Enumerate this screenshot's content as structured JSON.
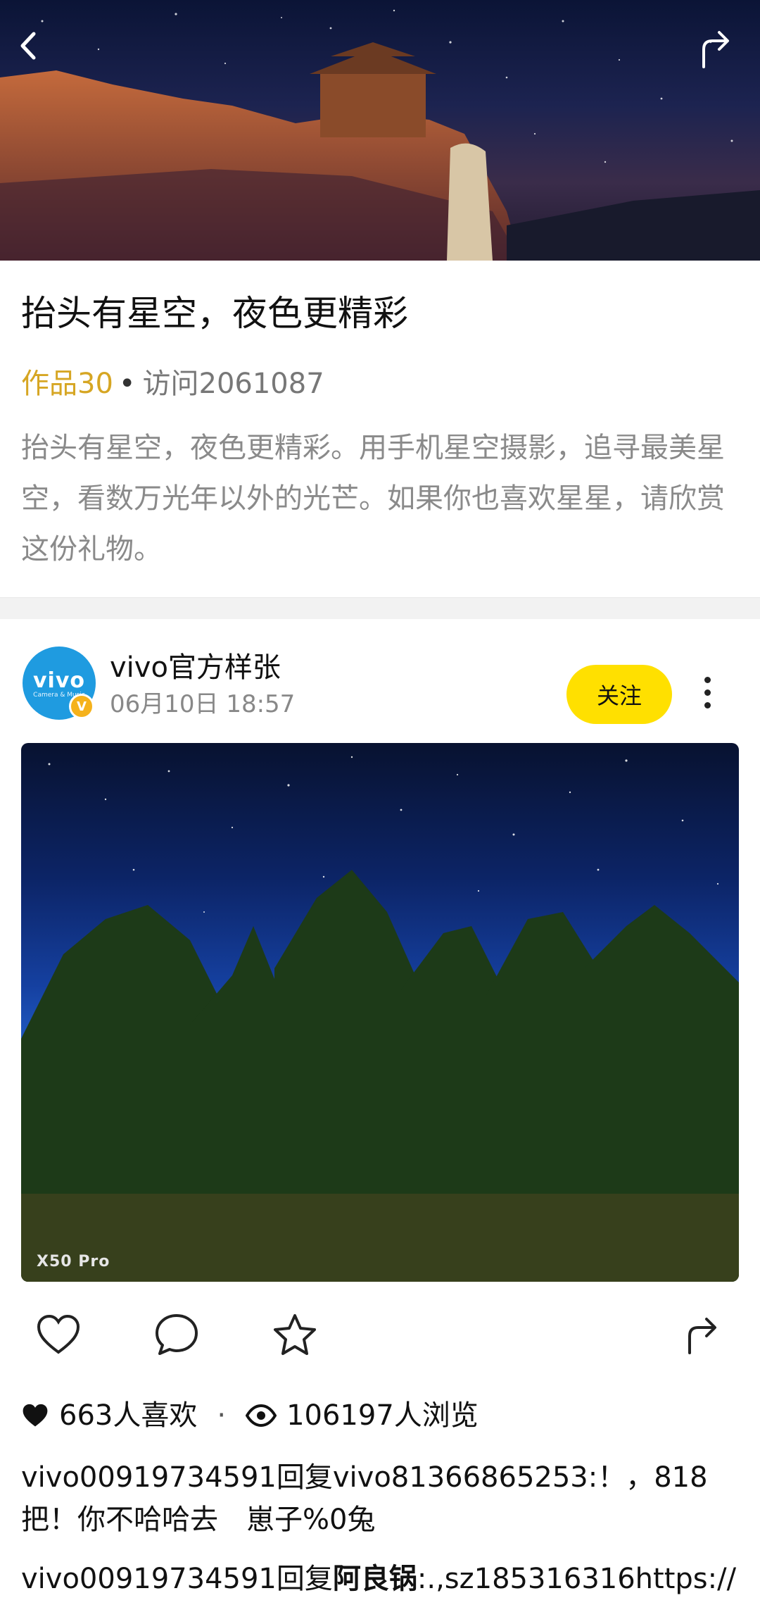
{
  "header": {
    "back_icon": "chevron-left-icon",
    "share_icon": "share-arrow-icon"
  },
  "collection": {
    "title": "抬头有星空，夜色更精彩",
    "works": "作品30",
    "visits": "访问2061087",
    "description": "抬头有星空，夜色更精彩。用手机星空摄影，追寻最美星空，看数万光年以外的光芒。如果你也喜欢星星，请欣赏这份礼物。"
  },
  "post": {
    "author": "vivo官方样张",
    "date": "06月10日 18:57",
    "avatar_logo": "vivo",
    "avatar_sub": "Camera & Music",
    "follow_label": "关注",
    "watermark": "X50 Pro",
    "likes": "663人喜欢",
    "views": "106197人浏览"
  },
  "comments": [
    {
      "user": "vivo00919734591",
      "reply_word": "回复",
      "target": "vivo81366865253",
      "text": ":！，818把！你不哈哈去　崽子%0兔"
    },
    {
      "user": "vivo00919734591",
      "reply_word": "回复",
      "target": "阿良锅",
      "text": ":.,sz185316316https://"
    }
  ],
  "colors": {
    "accent_yellow": "#ffe000",
    "works_gold": "#d6a623",
    "avatar_blue": "#1f9be0"
  }
}
